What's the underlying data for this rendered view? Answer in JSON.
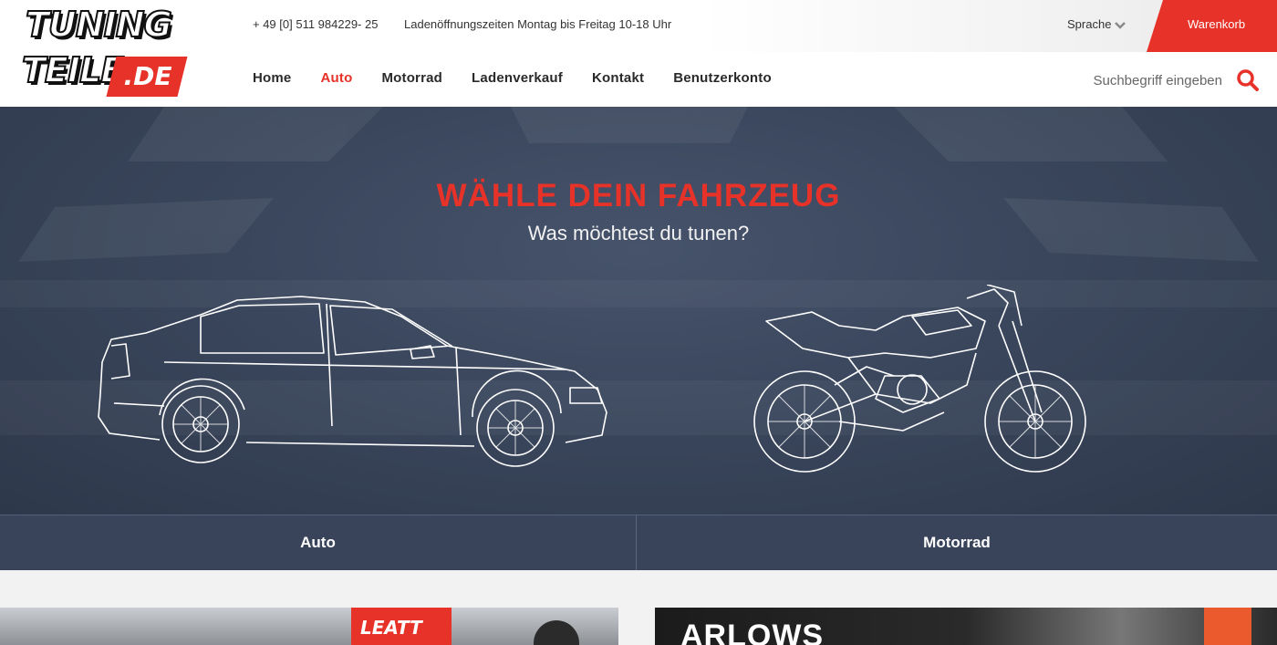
{
  "brand": {
    "logo_line1": "TUNING",
    "logo_line2": "TEILE",
    "logo_suffix": ".DE",
    "accent_color": "#e63228"
  },
  "topbar": {
    "phone": "+ 49 [0] 511 984229- 25",
    "hours": "Ladenöffnungszeiten Montag bis Freitag 10-18 Uhr",
    "language_label": "Sprache",
    "cart_label": "Warenkorb"
  },
  "nav": {
    "items": [
      {
        "label": "Home"
      },
      {
        "label": "Auto",
        "active": true
      },
      {
        "label": "Motorrad"
      },
      {
        "label": "Ladenverkauf"
      },
      {
        "label": "Kontakt"
      },
      {
        "label": "Benutzerkonto"
      }
    ]
  },
  "search": {
    "placeholder": "Suchbegriff eingeben",
    "icon": "search-icon"
  },
  "hero": {
    "title": "WÄHLE DEIN FAHRZEUG",
    "subtitle": "Was möchtest du tunen?",
    "choices": [
      {
        "label": "Auto"
      },
      {
        "label": "Motorrad"
      }
    ]
  },
  "teasers": {
    "left_brand": "LEATT",
    "right_brand": "ARLOWS"
  }
}
